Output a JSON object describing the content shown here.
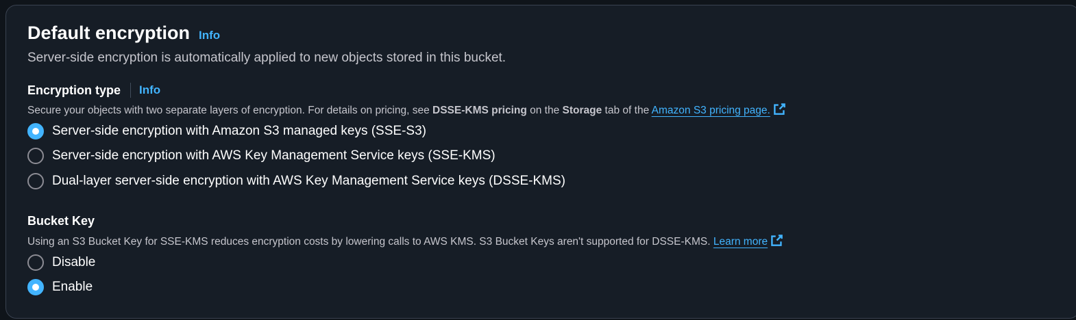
{
  "section": {
    "title": "Default encryption",
    "info": "Info",
    "description": "Server-side encryption is automatically applied to new objects stored in this bucket."
  },
  "encryption_type": {
    "label": "Encryption type",
    "info": "Info",
    "desc_prefix": "Secure your objects with two separate layers of encryption. For details on pricing, see ",
    "desc_bold1": "DSSE-KMS pricing",
    "desc_mid": " on the ",
    "desc_bold2": "Storage",
    "desc_suffix": " tab of the ",
    "link_text": "Amazon S3 pricing page.",
    "options": [
      {
        "label": "Server-side encryption with Amazon S3 managed keys (SSE-S3)",
        "selected": true
      },
      {
        "label": "Server-side encryption with AWS Key Management Service keys (SSE-KMS)",
        "selected": false
      },
      {
        "label": "Dual-layer server-side encryption with AWS Key Management Service keys (DSSE-KMS)",
        "selected": false
      }
    ]
  },
  "bucket_key": {
    "label": "Bucket Key",
    "description": "Using an S3 Bucket Key for SSE-KMS reduces encryption costs by lowering calls to AWS KMS. S3 Bucket Keys aren't supported for DSSE-KMS. ",
    "link_text": "Learn more",
    "options": [
      {
        "label": "Disable",
        "selected": false
      },
      {
        "label": "Enable",
        "selected": true
      }
    ]
  },
  "colors": {
    "background": "#0f141a",
    "panel": "#161d26",
    "accent": "#42b4ff",
    "text_secondary": "#c6c6cd"
  },
  "icons": {
    "external_link": "external-link-icon"
  }
}
